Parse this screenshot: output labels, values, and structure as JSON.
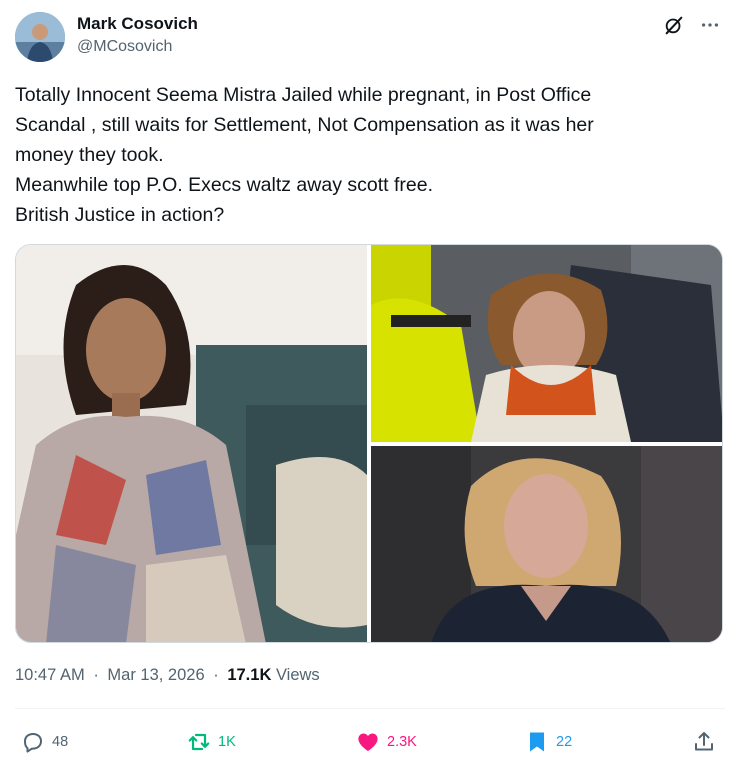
{
  "author": {
    "name": "Mark Cosovich",
    "handle": "@MCosovich",
    "avatar_icon": "avatar-photo"
  },
  "header_icons": [
    "grok-icon",
    "more-icon"
  ],
  "tweet": {
    "lines": [
      "Totally Innocent Seema Mistra Jailed while pregnant, in Post Office",
      "Scandal , still waits for Settlement, Not Compensation as it was her",
      "money they took.",
      "Meanwhile top P.O. Execs waltz away scott free.",
      "British Justice in action?"
    ]
  },
  "media": {
    "photos": [
      "photo-woman-on-sofa",
      "photo-woman-in-crowd",
      "photo-blonde-woman"
    ]
  },
  "meta": {
    "time": "10:47 AM",
    "date": "Mar 13, 2026",
    "views_count": "17.1K",
    "views_label": "Views",
    "dot": "·"
  },
  "actions": {
    "replies": "48",
    "reposts": "1K",
    "likes": "2.3K",
    "bookmarks": "22"
  },
  "colors": {
    "repost_active": "#00ba7c",
    "like_active": "#f91880",
    "bookmark_active": "#1d9bf0",
    "secondary_text": "#536471",
    "primary_text": "#0f1419"
  }
}
